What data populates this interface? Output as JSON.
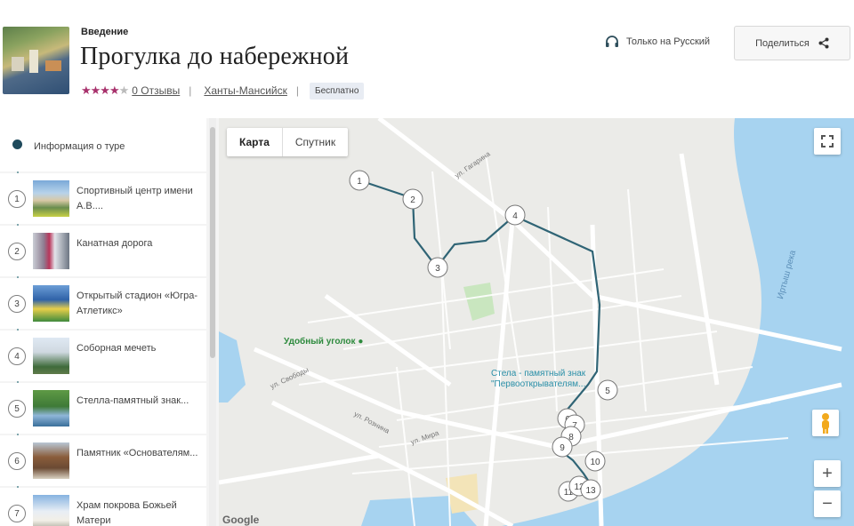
{
  "header": {
    "eyebrow": "Введение",
    "title": "Прогулка до набережной",
    "rating_stars_filled": 4,
    "rating_stars_total": 5,
    "reviews": "0 Отзывы",
    "city": "Ханты-Мансийск",
    "price_badge": "Бесплатно",
    "language": "Только на Русский",
    "share_label": "Поделиться",
    "icons": [
      "headphones-icon",
      "share-icon",
      "star-icon"
    ]
  },
  "sidebar": {
    "info_label": "Информация о туре",
    "stops": [
      {
        "num": "1",
        "label": "Спортивный центр имени А.В...."
      },
      {
        "num": "2",
        "label": "Канатная дорога"
      },
      {
        "num": "3",
        "label": "Открытый стадион «Югра-Атлетикс»"
      },
      {
        "num": "4",
        "label": "Соборная мечеть"
      },
      {
        "num": "5",
        "label": "Стелла-памятный знак..."
      },
      {
        "num": "6",
        "label": "Памятник «Основателям..."
      },
      {
        "num": "7",
        "label": "Храм покрова Божьей Матери"
      }
    ]
  },
  "map": {
    "tab_map": "Карта",
    "tab_satellite": "Спутник",
    "poi_park": "Удобный уголок",
    "poi_stella_line1": "Стела - памятный знак",
    "poi_stella_line2": "\"Первооткрывателям...",
    "river_label": "Иртыш река",
    "street_1": "ул. Гагарина",
    "street_2": "ул. Свободы",
    "street_3": "ул. Рознина",
    "street_4": "ул. Мира",
    "zoom_in": "+",
    "zoom_out": "−",
    "google": "Google",
    "markers": [
      "1",
      "2",
      "3",
      "4",
      "5",
      "6",
      "7",
      "8",
      "9",
      "10",
      "11",
      "12",
      "13"
    ],
    "route_color": "#2f6475",
    "water_color": "#a7d3f0",
    "park_color": "#c9e6bf"
  }
}
